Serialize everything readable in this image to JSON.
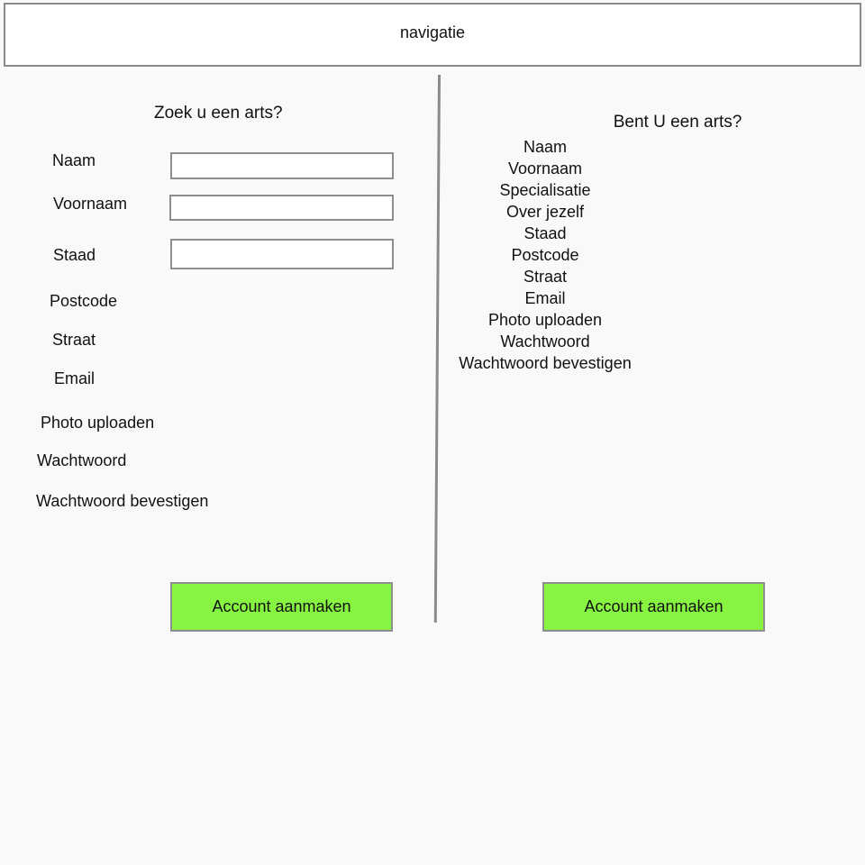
{
  "navigation": {
    "label": "navigatie"
  },
  "patient": {
    "heading": "Zoek u een arts?",
    "labels": {
      "naam": "Naam",
      "voornaam": "Voornaam",
      "staad": "Staad",
      "postcode": "Postcode",
      "straat": "Straat",
      "email": "Email",
      "photo": "Photo uploaden",
      "wachtwoord": "Wachtwoord",
      "bevestigen": "Wachtwoord bevestigen"
    },
    "inputs": {
      "naam": "",
      "voornaam": "",
      "staad": ""
    },
    "button": "Account aanmaken"
  },
  "doctor": {
    "heading": "Bent U een arts?",
    "fields": [
      "Naam",
      "Voornaam",
      "Specialisatie",
      "Over jezelf",
      "Staad",
      "Postcode",
      "Straat",
      "Email",
      "Photo uploaden",
      "Wachtwoord",
      "Wachtwoord bevestigen"
    ],
    "button": "Account aanmaken"
  }
}
